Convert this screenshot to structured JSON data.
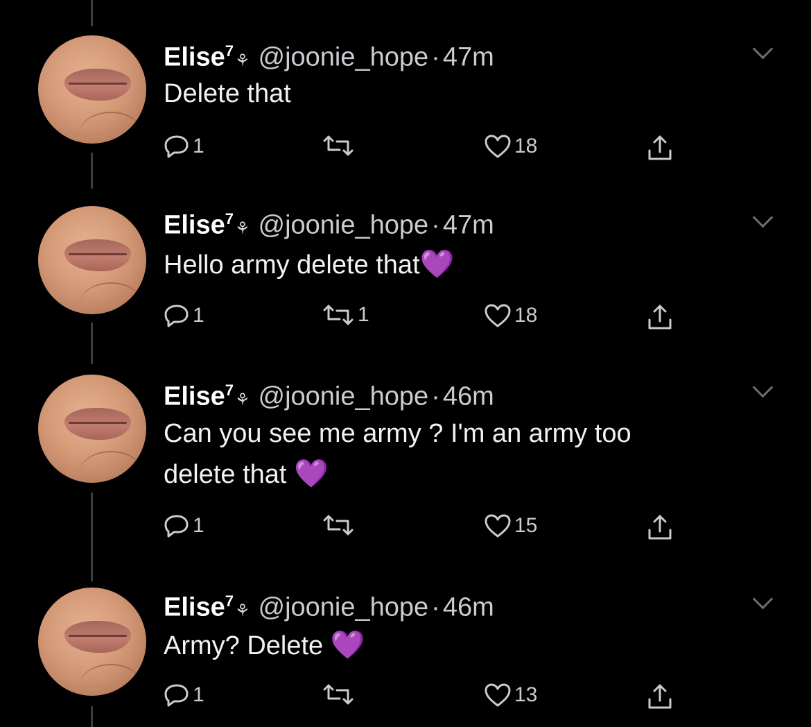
{
  "tweets": [
    {
      "name": "Elise",
      "sup": "7",
      "flower": "⚘",
      "handle": "@joonie_hope",
      "dot": "·",
      "time": "47m",
      "text": "Delete that",
      "heart": "",
      "replies": "1",
      "retweets": "",
      "likes": "18"
    },
    {
      "name": "Elise",
      "sup": "7",
      "flower": "⚘",
      "handle": "@joonie_hope",
      "dot": "·",
      "time": "47m",
      "text": "Hello army delete that",
      "heart": "💜",
      "replies": "1",
      "retweets": "1",
      "likes": "18"
    },
    {
      "name": "Elise",
      "sup": "7",
      "flower": "⚘",
      "handle": "@joonie_hope",
      "dot": "·",
      "time": "46m",
      "text": "Can you see me army ? I'm an army too\ndelete that ",
      "heart": "💜",
      "replies": "1",
      "retweets": "",
      "likes": "15"
    },
    {
      "name": "Elise",
      "sup": "7",
      "flower": "⚘",
      "handle": "@joonie_hope",
      "dot": "·",
      "time": "46m",
      "text": "Army? Delete ",
      "heart": "💜",
      "replies": "1",
      "retweets": "",
      "likes": "13"
    }
  ],
  "icons": {
    "reply": "reply-icon",
    "retweet": "retweet-icon",
    "like": "heart-icon",
    "share": "share-icon",
    "menu": "chevron-down-icon"
  },
  "colors": {
    "background": "#000000",
    "text": "#ffffff",
    "muted": "#c9ccd0",
    "emoji_heart": "#a27ee8"
  }
}
